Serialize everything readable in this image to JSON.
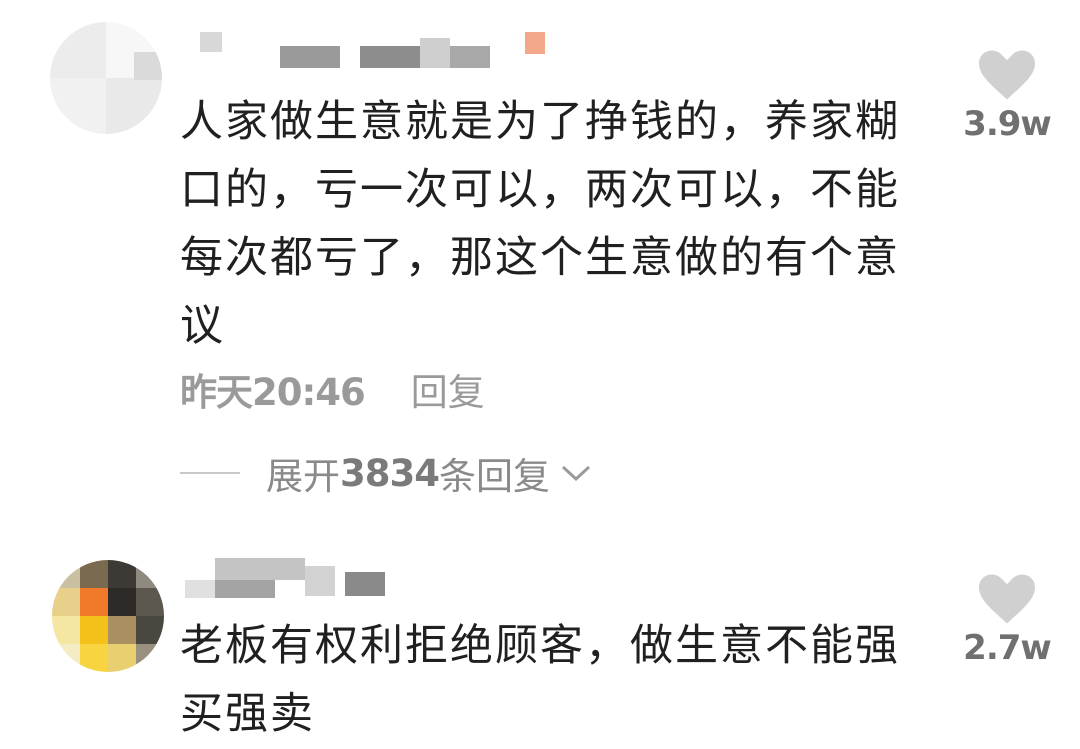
{
  "comments": [
    {
      "text": "人家做生意就是为了挣钱的，养家糊口的，亏一次可以，两次可以，不能每次都亏了，那这个生意做的有个意议",
      "time": "昨天20:46",
      "reply_label": "回复",
      "like_count": "3.9w",
      "expand": {
        "prefix": "展开",
        "count": "3834",
        "suffix": "条回复"
      }
    },
    {
      "text": "老板有权利拒绝顾客，做生意不能强买强卖",
      "like_count": "2.7w"
    }
  ],
  "icons": {
    "like": "heart-icon",
    "expand": "chevron-down-icon"
  },
  "colors": {
    "like_heart": "#d0d0d0",
    "meta_text": "#9a9a9a",
    "body_text": "#202020"
  }
}
